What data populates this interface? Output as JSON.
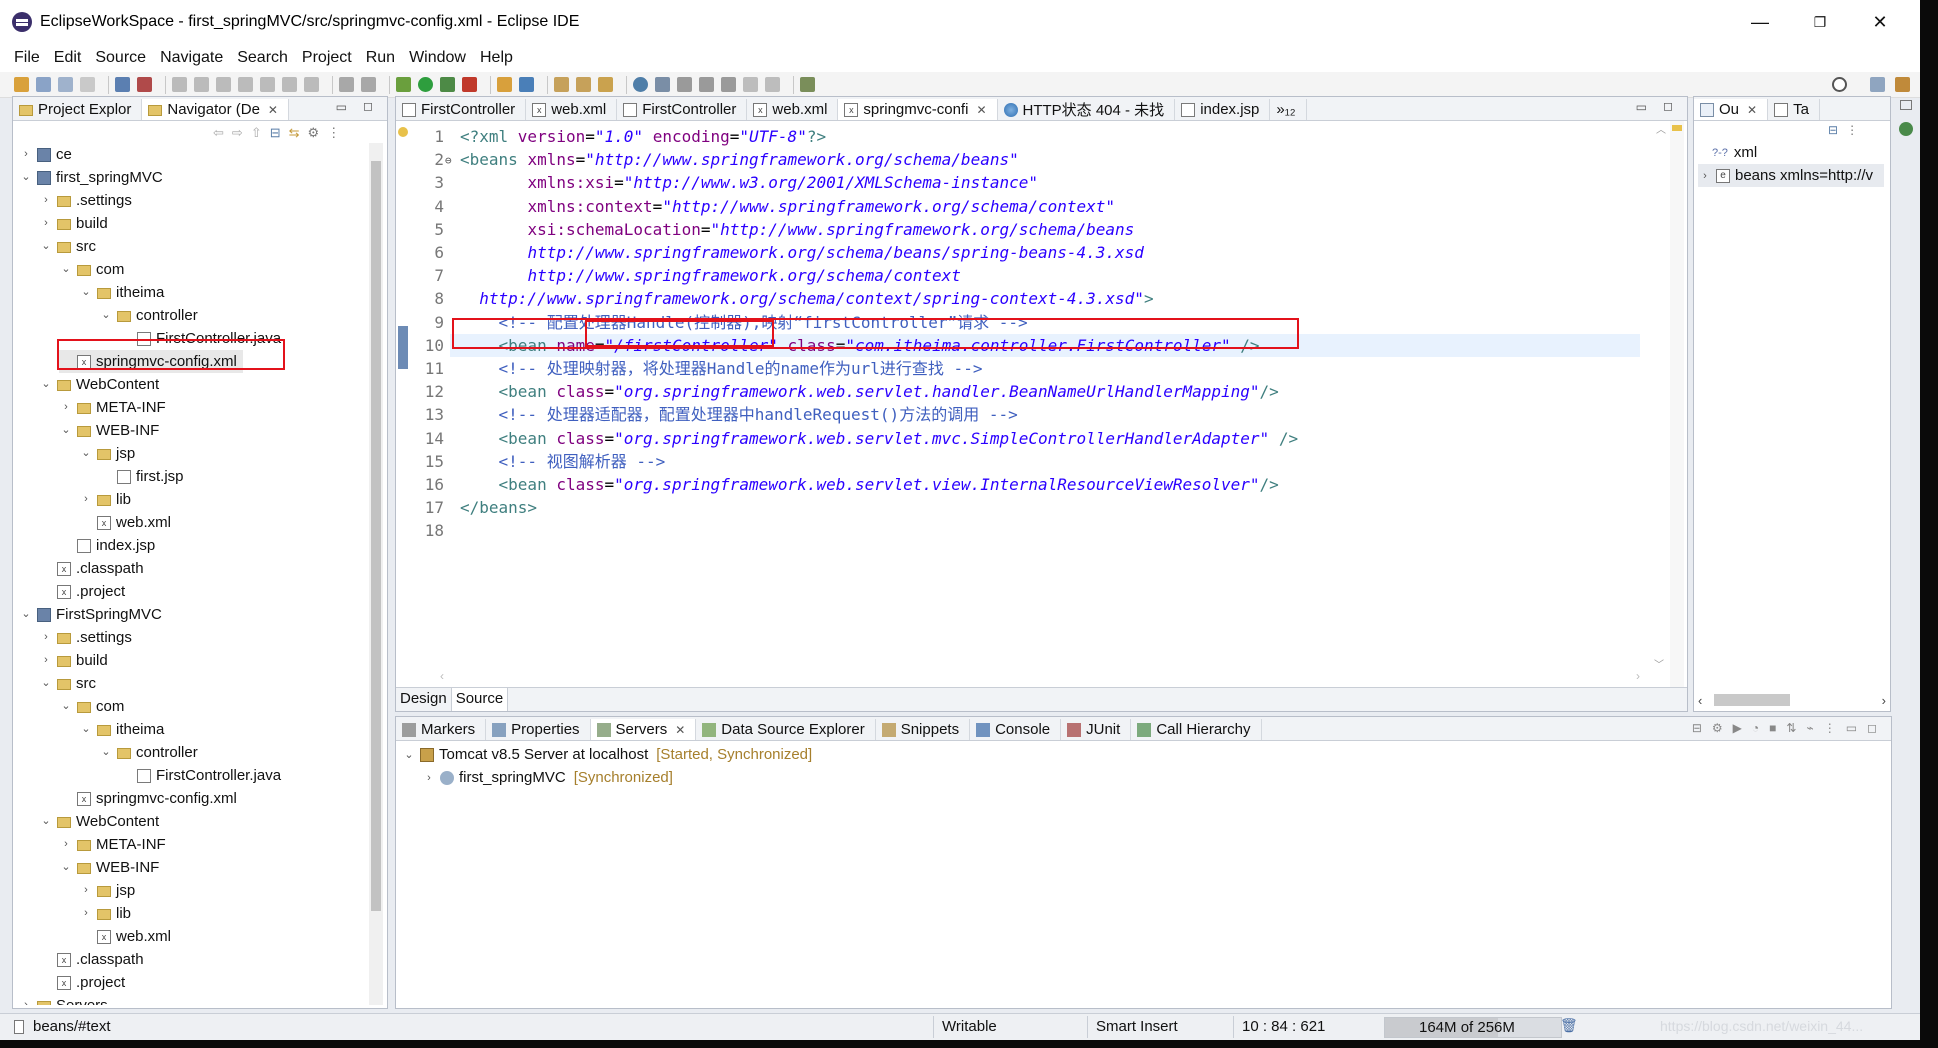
{
  "window": {
    "title": "EclipseWorkSpace - first_springMVC/src/springmvc-config.xml - Eclipse IDE"
  },
  "menu": [
    "File",
    "Edit",
    "Source",
    "Navigate",
    "Search",
    "Project",
    "Run",
    "Window",
    "Help"
  ],
  "left_tabs": [
    {
      "label": "Project Explor"
    },
    {
      "label": "Navigator (De"
    }
  ],
  "tree": [
    {
      "label": "ce",
      "depth": 0,
      "tw": "›",
      "icon": "proj"
    },
    {
      "label": "first_springMVC",
      "depth": 0,
      "tw": "⌄",
      "icon": "proj"
    },
    {
      "label": ".settings",
      "depth": 1,
      "tw": "›",
      "icon": "folder"
    },
    {
      "label": "build",
      "depth": 1,
      "tw": "›",
      "icon": "folder"
    },
    {
      "label": "src",
      "depth": 1,
      "tw": "⌄",
      "icon": "folder"
    },
    {
      "label": "com",
      "depth": 2,
      "tw": "⌄",
      "icon": "folder"
    },
    {
      "label": "itheima",
      "depth": 3,
      "tw": "⌄",
      "icon": "folder"
    },
    {
      "label": "controller",
      "depth": 4,
      "tw": "⌄",
      "icon": "folder"
    },
    {
      "label": "FirstController.java",
      "depth": 5,
      "tw": "",
      "icon": "java"
    },
    {
      "label": "springmvc-config.xml",
      "depth": 2,
      "tw": "",
      "icon": "xml",
      "selected": true
    },
    {
      "label": "WebContent",
      "depth": 1,
      "tw": "⌄",
      "icon": "folder"
    },
    {
      "label": "META-INF",
      "depth": 2,
      "tw": "›",
      "icon": "folder"
    },
    {
      "label": "WEB-INF",
      "depth": 2,
      "tw": "⌄",
      "icon": "folder"
    },
    {
      "label": "jsp",
      "depth": 3,
      "tw": "⌄",
      "icon": "folder"
    },
    {
      "label": "first.jsp",
      "depth": 4,
      "tw": "",
      "icon": "java"
    },
    {
      "label": "lib",
      "depth": 3,
      "tw": "›",
      "icon": "folder"
    },
    {
      "label": "web.xml",
      "depth": 3,
      "tw": "",
      "icon": "xml"
    },
    {
      "label": "index.jsp",
      "depth": 2,
      "tw": "",
      "icon": "java"
    },
    {
      "label": ".classpath",
      "depth": 1,
      "tw": "",
      "icon": "xml"
    },
    {
      "label": ".project",
      "depth": 1,
      "tw": "",
      "icon": "xml"
    },
    {
      "label": "FirstSpringMVC",
      "depth": 0,
      "tw": "⌄",
      "icon": "proj"
    },
    {
      "label": ".settings",
      "depth": 1,
      "tw": "›",
      "icon": "folder"
    },
    {
      "label": "build",
      "depth": 1,
      "tw": "›",
      "icon": "folder"
    },
    {
      "label": "src",
      "depth": 1,
      "tw": "⌄",
      "icon": "folder"
    },
    {
      "label": "com",
      "depth": 2,
      "tw": "⌄",
      "icon": "folder"
    },
    {
      "label": "itheima",
      "depth": 3,
      "tw": "⌄",
      "icon": "folder"
    },
    {
      "label": "controller",
      "depth": 4,
      "tw": "⌄",
      "icon": "folder"
    },
    {
      "label": "FirstController.java",
      "depth": 5,
      "tw": "",
      "icon": "java"
    },
    {
      "label": "springmvc-config.xml",
      "depth": 2,
      "tw": "",
      "icon": "xml"
    },
    {
      "label": "WebContent",
      "depth": 1,
      "tw": "⌄",
      "icon": "folder"
    },
    {
      "label": "META-INF",
      "depth": 2,
      "tw": "›",
      "icon": "folder"
    },
    {
      "label": "WEB-INF",
      "depth": 2,
      "tw": "⌄",
      "icon": "folder"
    },
    {
      "label": "jsp",
      "depth": 3,
      "tw": "›",
      "icon": "folder"
    },
    {
      "label": "lib",
      "depth": 3,
      "tw": "›",
      "icon": "folder"
    },
    {
      "label": "web.xml",
      "depth": 3,
      "tw": "",
      "icon": "xml"
    },
    {
      "label": ".classpath",
      "depth": 1,
      "tw": "",
      "icon": "xml"
    },
    {
      "label": ".project",
      "depth": 1,
      "tw": "",
      "icon": "xml"
    },
    {
      "label": "Servers",
      "depth": 0,
      "tw": "›",
      "icon": "folder"
    }
  ],
  "editor_tabs": [
    {
      "label": "FirstController",
      "icon": "java"
    },
    {
      "label": "web.xml",
      "icon": "xml"
    },
    {
      "label": "FirstController",
      "icon": "java"
    },
    {
      "label": "web.xml",
      "icon": "xml"
    },
    {
      "label": "springmvc-confi",
      "icon": "xml",
      "active": true
    },
    {
      "label": "HTTP状态 404 - 未找",
      "icon": "globe"
    },
    {
      "label": "index.jsp",
      "icon": "java"
    },
    {
      "label": "»₁₂",
      "icon": ""
    }
  ],
  "code_lines": [
    [
      [
        "tag",
        "<?xml "
      ],
      [
        "attr",
        "version"
      ],
      [
        "txt",
        "="
      ],
      [
        "val",
        "\"1.0\""
      ],
      [
        "txt",
        " "
      ],
      [
        "attr",
        "encoding"
      ],
      [
        "txt",
        "="
      ],
      [
        "val",
        "\"UTF-8\""
      ],
      [
        "tag",
        "?>"
      ]
    ],
    [
      [
        "tag",
        "<beans "
      ],
      [
        "attr",
        "xmlns"
      ],
      [
        "txt",
        "="
      ],
      [
        "val",
        "\"http://www.springframework.org/schema/beans\""
      ]
    ],
    [
      [
        "txt",
        "       "
      ],
      [
        "attr",
        "xmlns:xsi"
      ],
      [
        "txt",
        "="
      ],
      [
        "val",
        "\"http://www.w3.org/2001/XMLSchema-instance\""
      ]
    ],
    [
      [
        "txt",
        "       "
      ],
      [
        "attr",
        "xmlns:context"
      ],
      [
        "txt",
        "="
      ],
      [
        "val",
        "\"http://www.springframework.org/schema/context\""
      ]
    ],
    [
      [
        "txt",
        "       "
      ],
      [
        "attr",
        "xsi:schemaLocation"
      ],
      [
        "txt",
        "="
      ],
      [
        "val",
        "\"http://www.springframework.org/schema/beans"
      ]
    ],
    [
      [
        "txt",
        "       "
      ],
      [
        "val",
        "http://www.springframework.org/schema/beans/spring-beans-4.3.xsd"
      ]
    ],
    [
      [
        "txt",
        "       "
      ],
      [
        "val",
        "http://www.springframework.org/schema/context"
      ]
    ],
    [
      [
        "txt",
        "  "
      ],
      [
        "val",
        "http://www.springframework.org/schema/context/spring-context-4.3.xsd\""
      ],
      [
        "tag",
        ">"
      ]
    ],
    [
      [
        "txt",
        "    "
      ],
      [
        "com",
        "<!-- 配置处理器Handle(控制器),映射“firstController”请求 -->"
      ]
    ],
    [
      [
        "txt",
        "    "
      ],
      [
        "tag",
        "<bean "
      ],
      [
        "attr",
        "name"
      ],
      [
        "txt",
        "="
      ],
      [
        "val",
        "\"/firstController\""
      ],
      [
        "txt",
        " "
      ],
      [
        "attr",
        "class"
      ],
      [
        "txt",
        "="
      ],
      [
        "val",
        "\"com.itheima.controller.FirstController\""
      ],
      [
        "txt",
        " "
      ],
      [
        "tag",
        "/>"
      ]
    ],
    [
      [
        "txt",
        "    "
      ],
      [
        "com",
        "<!-- 处理映射器，将处理器Handle的name作为url进行查找 -->"
      ]
    ],
    [
      [
        "txt",
        "    "
      ],
      [
        "tag",
        "<bean "
      ],
      [
        "attr",
        "class"
      ],
      [
        "txt",
        "="
      ],
      [
        "val",
        "\"org.springframework.web.servlet.handler.BeanNameUrlHandlerMapping\""
      ],
      [
        "tag",
        "/>"
      ]
    ],
    [
      [
        "txt",
        "    "
      ],
      [
        "com",
        "<!-- 处理器适配器，配置处理器中handleRequest()方法的调用 -->"
      ]
    ],
    [
      [
        "txt",
        "    "
      ],
      [
        "tag",
        "<bean "
      ],
      [
        "attr",
        "class"
      ],
      [
        "txt",
        "="
      ],
      [
        "val",
        "\"org.springframework.web.servlet.mvc.SimpleControllerHandlerAdapter\""
      ],
      [
        "txt",
        " "
      ],
      [
        "tag",
        "/>"
      ]
    ],
    [
      [
        "txt",
        "    "
      ],
      [
        "com",
        "<!-- 视图解析器 -->"
      ]
    ],
    [
      [
        "txt",
        "    "
      ],
      [
        "tag",
        "<bean "
      ],
      [
        "attr",
        "class"
      ],
      [
        "txt",
        "="
      ],
      [
        "val",
        "\"org.springframework.web.servlet.view.InternalResourceViewResolver\""
      ],
      [
        "tag",
        "/>"
      ]
    ],
    [
      [
        "tag",
        "</beans>"
      ]
    ],
    []
  ],
  "editor_bottom_tabs": [
    "Design",
    "Source"
  ],
  "outline": {
    "tabs": [
      "Ou",
      "Ta"
    ],
    "items": [
      {
        "label": "xml",
        "prefix": "?-?"
      },
      {
        "label": "beans xmlns=http://v",
        "prefix": "e"
      }
    ]
  },
  "bottom_tabs": [
    "Markers",
    "Properties",
    "Servers",
    "Data Source Explorer",
    "Snippets",
    "Console",
    "JUnit",
    "Call Hierarchy"
  ],
  "servers": [
    {
      "label": "Tomcat v8.5 Server at localhost",
      "status": "[Started, Synchronized]"
    },
    {
      "label": "first_springMVC",
      "status": "[Synchronized]"
    }
  ],
  "status": {
    "path": "beans/#text",
    "writable": "Writable",
    "insert": "Smart Insert",
    "position": "10 : 84 : 621",
    "memory": "164M of 256M",
    "watermark": "https://blog.csdn.net/weixin_44..."
  }
}
